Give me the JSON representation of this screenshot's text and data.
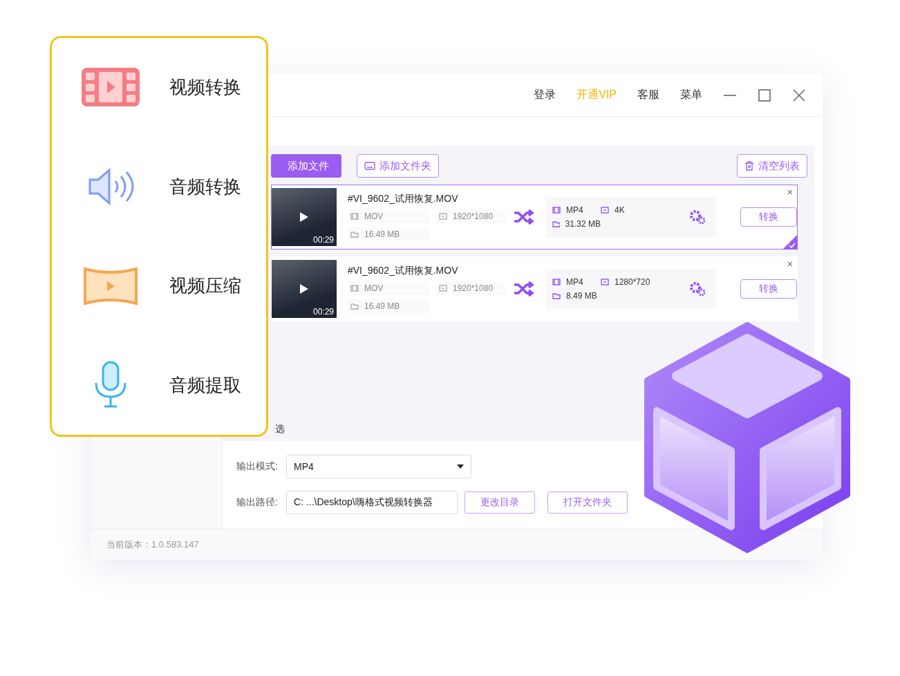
{
  "window": {
    "menu": [
      {
        "label": "登录",
        "kind": "link"
      },
      {
        "label": "开通VIP",
        "kind": "vip"
      },
      {
        "label": "客服",
        "kind": "link"
      },
      {
        "label": "菜单",
        "kind": "link"
      }
    ]
  },
  "features": [
    {
      "label": "视频转换",
      "kind": "video"
    },
    {
      "label": "音频转换",
      "kind": "audio"
    },
    {
      "label": "视频压缩",
      "kind": "compress"
    },
    {
      "label": "音频提取",
      "kind": "mic"
    }
  ],
  "toolbar": {
    "add_file": "添加文件",
    "add_folder": "添加文件夹",
    "clear_list": "清空列表"
  },
  "files": [
    {
      "name": "#VI_9602_试用恢复.MOV",
      "duration": "00:29",
      "source": {
        "format": "MOV",
        "resolution": "1920*1080",
        "size": "16.49 MB"
      },
      "target": {
        "format": "MP4",
        "resolution": "4K",
        "size": "31.32 MB"
      },
      "button": "转换",
      "remove": "×",
      "selected": true
    },
    {
      "name": "#VI_9602_试用恢复.MOV",
      "duration": "00:29",
      "source": {
        "format": "MOV",
        "resolution": "1920*1080",
        "size": "16.49 MB"
      },
      "target": {
        "format": "MP4",
        "resolution": "1280*720",
        "size": "8.49 MB"
      },
      "button": "转换",
      "remove": "×",
      "selected": false
    }
  ],
  "list_footer": "选",
  "output": {
    "mode_label": "输出模式:",
    "mode_value": "MP4",
    "path_label": "输出路径:",
    "path_value": "C: ...\\Desktop\\嗨格式视频转换器",
    "change_dir": "更改目录",
    "open_folder": "打开文件夹"
  },
  "status_bar": "当前版本：1.0.583.147"
}
